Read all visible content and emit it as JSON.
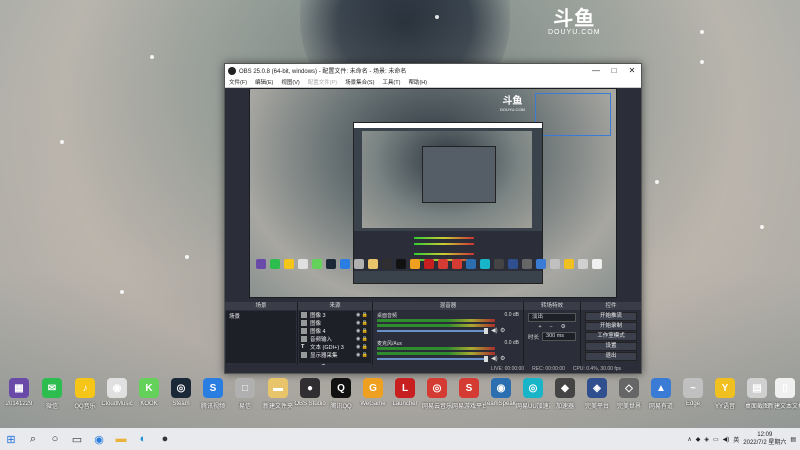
{
  "wallpaper": {
    "logo_cn": "斗鱼",
    "logo_en": "DOUYU.COM"
  },
  "obs": {
    "title": "OBS 25.0.8 (64-bit, windows) - 配置文件: 未命名 - 场景: 未命名",
    "menu": [
      "文件(F)",
      "编辑(E)",
      "视图(V)",
      "配置文件(P)",
      "场景集合(S)",
      "工具(T)",
      "帮助(H)"
    ],
    "preview_logo_cn": "斗鱼",
    "preview_logo_en": "DOUYU.COM",
    "docks": {
      "scenes_header": "场景",
      "sources_header": "来源",
      "mixer_header": "混音器",
      "transitions_header": "转场特效",
      "controls_header": "控件",
      "scenes": [
        "场景"
      ],
      "sources": [
        {
          "label": "图像 3",
          "icon": "image-icon"
        },
        {
          "label": "图像",
          "icon": "image-icon"
        },
        {
          "label": "图像 4",
          "icon": "image-icon"
        },
        {
          "label": "音频输入",
          "icon": "mic-icon"
        },
        {
          "label": "文本 (GDI+) 3",
          "icon": "text-icon"
        },
        {
          "label": "显示器采集",
          "icon": "monitor-icon"
        }
      ],
      "mixer": [
        {
          "name": "桌面音频",
          "db": "0.0 dB"
        },
        {
          "name": "麦克风/Aux",
          "db": "0.0 dB"
        }
      ],
      "transition_type": "淡出",
      "duration_label": "时长",
      "duration_value": "300 ms",
      "controls": [
        "开始推流",
        "开始录制",
        "工作室模式",
        "设置",
        "退出"
      ]
    },
    "status": {
      "live": "LIVE: 00:00:00",
      "rec": "REC: 00:00:00",
      "cpu": "CPU: 0.4%, 30.00 fps"
    }
  },
  "desktop_icons": [
    {
      "label": "20141229",
      "color": "#6a4aa8",
      "glyph": "▦"
    },
    {
      "label": "微信",
      "color": "#2dbd4e",
      "glyph": "✉"
    },
    {
      "label": "QQ音乐",
      "color": "#f5c518",
      "glyph": "♪"
    },
    {
      "label": "CloudMusic",
      "color": "#e0e0e0",
      "glyph": "◉"
    },
    {
      "label": "KOOK",
      "color": "#64d15a",
      "glyph": "K"
    },
    {
      "label": "Steam",
      "color": "#1b2838",
      "glyph": "◎"
    },
    {
      "label": "腾讯视频",
      "color": "#2a7de1",
      "glyph": "S"
    },
    {
      "label": "易信",
      "color": "#b0b0b0",
      "glyph": "□"
    },
    {
      "label": "新建文件夹",
      "color": "#e8c46a",
      "glyph": "▬"
    },
    {
      "label": "OBS Studio",
      "color": "#302e31",
      "glyph": "●"
    },
    {
      "label": "腾讯QQ",
      "color": "#111",
      "glyph": "Q"
    },
    {
      "label": "WeGame",
      "color": "#f0a020",
      "glyph": "G"
    },
    {
      "label": "Launcher",
      "color": "#c82020",
      "glyph": "L"
    },
    {
      "label": "网易云音乐",
      "color": "#d43c33",
      "glyph": "◎"
    },
    {
      "label": "网易游戏平台",
      "color": "#d43c33",
      "glyph": "S"
    },
    {
      "label": "TeamSpeak 3",
      "color": "#2c6fb0",
      "glyph": "◉"
    },
    {
      "label": "网易UU加速器",
      "color": "#18b4c8",
      "glyph": "◎"
    },
    {
      "label": "加速器",
      "color": "#444",
      "glyph": "◆"
    },
    {
      "label": "完美平台",
      "color": "#2f4f8f",
      "glyph": "◈"
    },
    {
      "label": "完美世界",
      "color": "#666",
      "glyph": "◇"
    },
    {
      "label": "网易有道",
      "color": "#3a7bd5",
      "glyph": "▲"
    },
    {
      "label": "Edge",
      "color": "#c0c0c0",
      "glyph": "~"
    },
    {
      "label": "YY语音",
      "color": "#f0c020",
      "glyph": "Y"
    },
    {
      "label": "桌面截图",
      "color": "#d0d0d0",
      "glyph": "▤"
    },
    {
      "label": "新建文本文档",
      "color": "#f0f0f0",
      "glyph": "▯"
    }
  ],
  "taskbar": {
    "time": "12:09",
    "date": "2022/7/2 星期六"
  }
}
